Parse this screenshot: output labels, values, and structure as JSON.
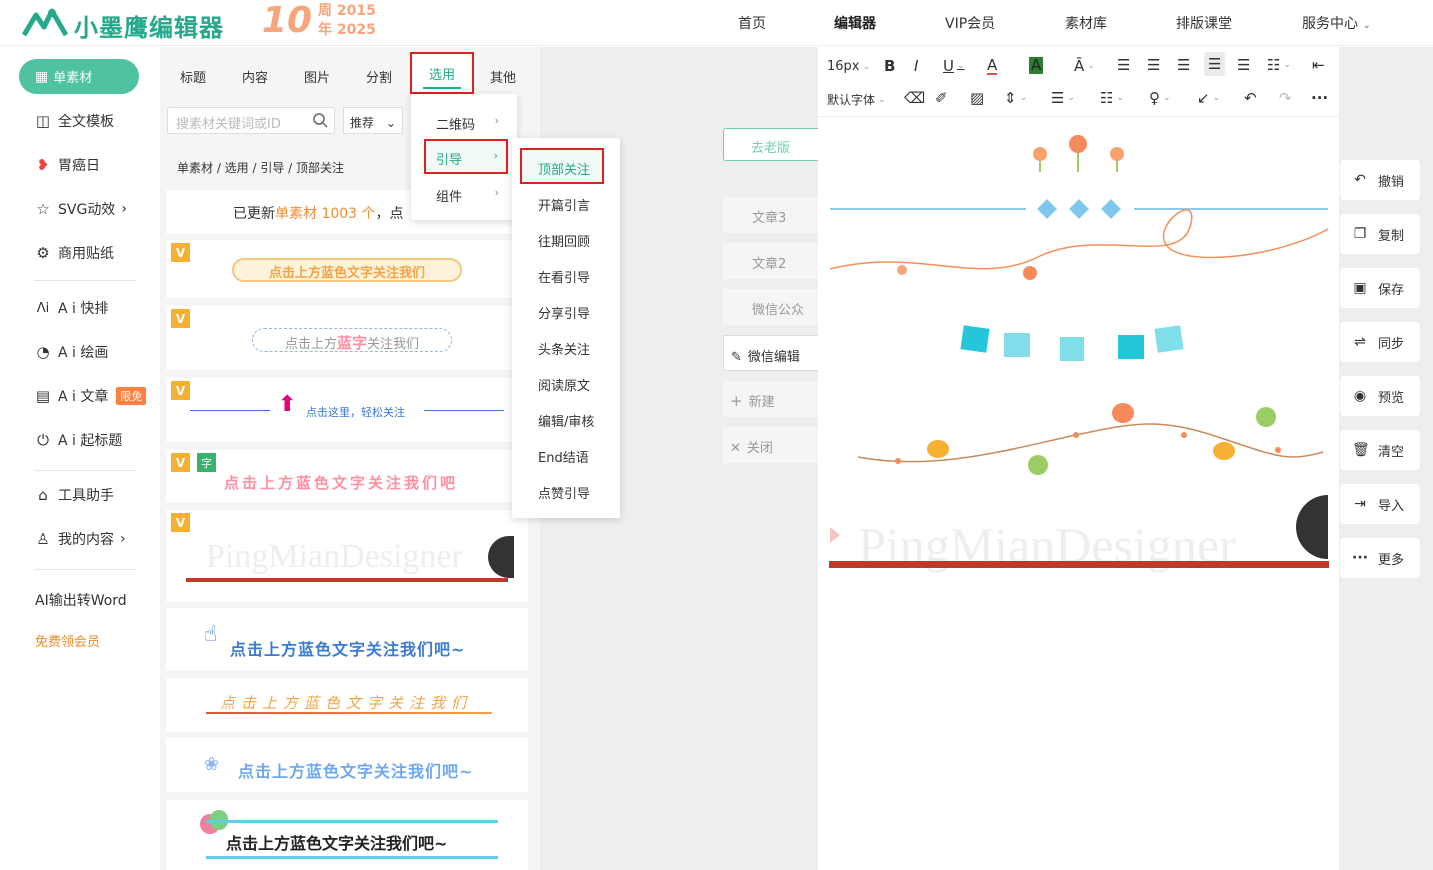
{
  "header": {
    "logo_text": "小墨鹰编辑器",
    "anniv_num": "10",
    "anniv_line1": "周 2015",
    "anniv_line2": "年 2025",
    "nav": [
      "首页",
      "编辑器",
      "VIP会员",
      "素材库",
      "排版课堂",
      "服务中心"
    ]
  },
  "sidebar": {
    "active": "单素材",
    "items": [
      "全文模板",
      "胃癌日",
      "SVG动效",
      "商用贴纸",
      "A i 快排",
      "A i 绘画",
      "A i 文章",
      "A i 起标题",
      "工具助手",
      "我的内容",
      "AI输出转Word",
      "免费领会员"
    ],
    "badge": "限免"
  },
  "panel": {
    "tabs": [
      "标题",
      "内容",
      "图片",
      "分割",
      "选用",
      "其他"
    ],
    "search_placeholder": "搜素材关键词或ID",
    "sort": "推荐",
    "breadcrumb": "单素材 / 选用 / 引导 / 顶部关注",
    "notice_pre": "已更新",
    "notice_hl": "单素材 1003 个",
    "notice_post": "，点",
    "cards": [
      "点击上方蓝色文字关注我们",
      "点击上方蓝字关注我们",
      "点击这里，轻松关注",
      "点击上方蓝色文字关注我们吧",
      "PingMianDesigner",
      "点击上方蓝色文字关注我们吧~",
      "点击上方蓝色文字关注我们",
      "点击上方蓝色文字关注我们吧~",
      "点击上方蓝色文字关注我们吧~"
    ],
    "card2_pre": "点击上方",
    "card2_hl": "蓝字",
    "card2_post": "关注我们",
    "tag_v": "V",
    "tag_z": "字"
  },
  "menu1": {
    "items": [
      "二维码",
      "引导",
      "组件"
    ]
  },
  "menu2": {
    "items": [
      "顶部关注",
      "开篇引言",
      "往期回顾",
      "在看引导",
      "分享引导",
      "头条关注",
      "阅读原文",
      "编辑/审核",
      "End结语",
      "点赞引导"
    ]
  },
  "doc": {
    "old_version": "去老版",
    "tabs": [
      "文章3",
      "文章2",
      "微信公众",
      "微信编辑"
    ],
    "new": "新建",
    "close": "关闭"
  },
  "toolbar": {
    "font_size": "16px",
    "font_family": "默认字体"
  },
  "canvas": {
    "watermark": "PingMianDesigner"
  },
  "actions": [
    "撤销",
    "复制",
    "保存",
    "同步",
    "预览",
    "清空",
    "导入",
    "更多"
  ],
  "colors": {
    "brand": "#26a98b",
    "accent": "#4fc3a1",
    "highlight_border": "#e02020",
    "orange": "#f08c2c"
  }
}
